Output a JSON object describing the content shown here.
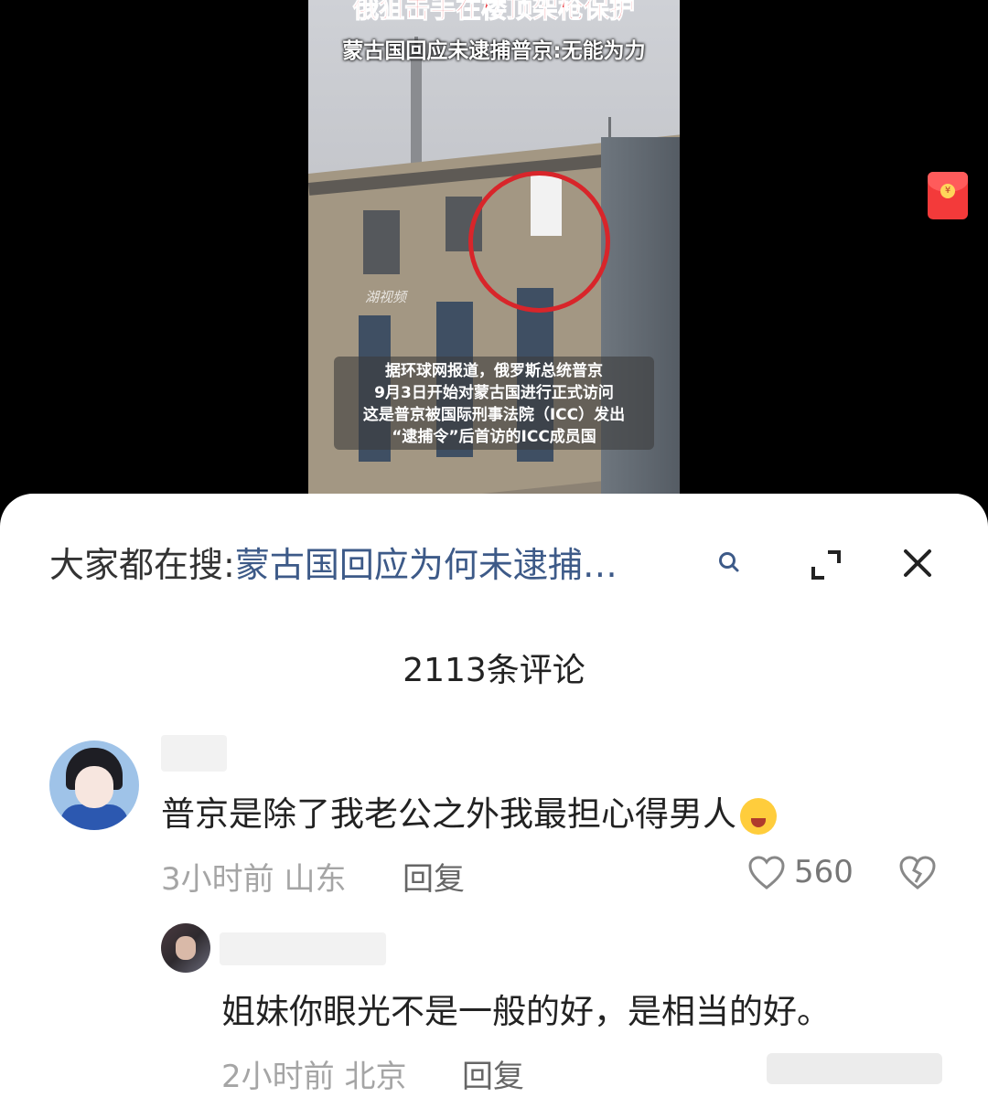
{
  "video": {
    "title_top": "俄狙击手在楼顶架枪保护",
    "title_sub": "蒙古国回应未逮捕普京:无能为力",
    "watermark": "湖视频",
    "caption_lines": [
      "据环球网报道，俄罗斯总统普京",
      "9月3日开始对蒙古国进行正式访问",
      "这是普京被国际刑事法院（ICC）发出",
      "“逮捕令”后首访的ICC成员国"
    ],
    "red_packet_symbol": "¥"
  },
  "search": {
    "prefix": "大家都在搜:",
    "query": "蒙古国回应为何未逮捕…"
  },
  "comments_header": "2113条评论",
  "comments": [
    {
      "text": "普京是除了我老公之外我最担心得男人",
      "time": "3小时前",
      "location": "山东",
      "reply_label": "回复",
      "likes": "560"
    },
    {
      "text": "姐妹你眼光不是一般的好，是相当的好。",
      "time": "2小时前",
      "location": "北京",
      "reply_label": "回复"
    }
  ],
  "colors": {
    "search_query": "#3d5a88",
    "red_circle": "#d8252a",
    "red_packet": "#f33a3a"
  }
}
